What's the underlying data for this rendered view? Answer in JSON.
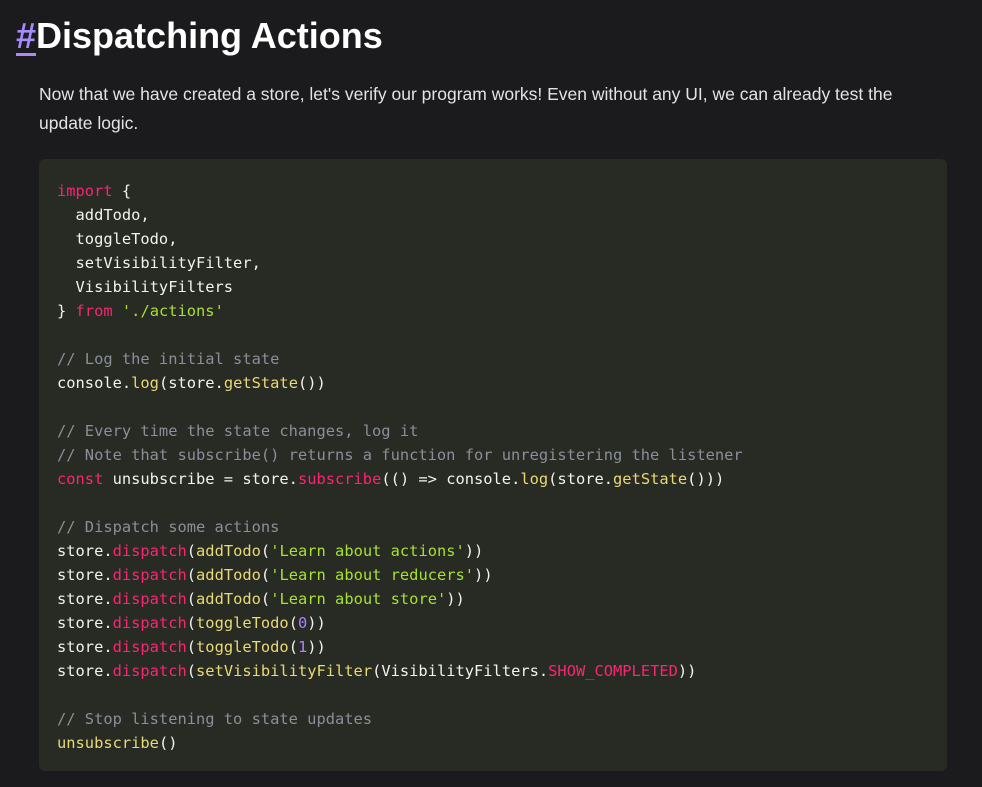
{
  "heading": {
    "hash": "#",
    "title": "Dispatching Actions"
  },
  "paragraph": "Now that we have created a store, let's verify our program works! Even without any UI, we can already test the update logic.",
  "code": {
    "language": "javascript",
    "lines": [
      [
        {
          "t": "import",
          "c": "kw"
        },
        {
          "t": " {",
          "c": "pl"
        }
      ],
      [
        {
          "t": "  addTodo,",
          "c": "pl"
        }
      ],
      [
        {
          "t": "  toggleTodo,",
          "c": "pl"
        }
      ],
      [
        {
          "t": "  setVisibilityFilter,",
          "c": "pl"
        }
      ],
      [
        {
          "t": "  VisibilityFilters",
          "c": "pl"
        }
      ],
      [
        {
          "t": "} ",
          "c": "pl"
        },
        {
          "t": "from",
          "c": "kw"
        },
        {
          "t": " ",
          "c": "pl"
        },
        {
          "t": "'./actions'",
          "c": "str"
        }
      ],
      [],
      [
        {
          "t": "// Log the initial state",
          "c": "cm"
        }
      ],
      [
        {
          "t": "console.",
          "c": "pl"
        },
        {
          "t": "log",
          "c": "fn"
        },
        {
          "t": "(store.",
          "c": "pl"
        },
        {
          "t": "getState",
          "c": "fn"
        },
        {
          "t": "())",
          "c": "pl"
        }
      ],
      [],
      [
        {
          "t": "// Every time the state changes, log it",
          "c": "cm"
        }
      ],
      [
        {
          "t": "// Note that subscribe() returns a function for unregistering the listener",
          "c": "cm"
        }
      ],
      [
        {
          "t": "const",
          "c": "kw"
        },
        {
          "t": " unsubscribe = store.",
          "c": "pl"
        },
        {
          "t": "subscribe",
          "c": "fn2"
        },
        {
          "t": "(() => console.",
          "c": "pl"
        },
        {
          "t": "log",
          "c": "fn"
        },
        {
          "t": "(store.",
          "c": "pl"
        },
        {
          "t": "getState",
          "c": "fn"
        },
        {
          "t": "()))",
          "c": "pl"
        }
      ],
      [],
      [
        {
          "t": "// Dispatch some actions",
          "c": "cm"
        }
      ],
      [
        {
          "t": "store.",
          "c": "pl"
        },
        {
          "t": "dispatch",
          "c": "fn2"
        },
        {
          "t": "(",
          "c": "pl"
        },
        {
          "t": "addTodo",
          "c": "fn3"
        },
        {
          "t": "(",
          "c": "pl"
        },
        {
          "t": "'Learn about actions'",
          "c": "str"
        },
        {
          "t": "))",
          "c": "pl"
        }
      ],
      [
        {
          "t": "store.",
          "c": "pl"
        },
        {
          "t": "dispatch",
          "c": "fn2"
        },
        {
          "t": "(",
          "c": "pl"
        },
        {
          "t": "addTodo",
          "c": "fn3"
        },
        {
          "t": "(",
          "c": "pl"
        },
        {
          "t": "'Learn about reducers'",
          "c": "str"
        },
        {
          "t": "))",
          "c": "pl"
        }
      ],
      [
        {
          "t": "store.",
          "c": "pl"
        },
        {
          "t": "dispatch",
          "c": "fn2"
        },
        {
          "t": "(",
          "c": "pl"
        },
        {
          "t": "addTodo",
          "c": "fn3"
        },
        {
          "t": "(",
          "c": "pl"
        },
        {
          "t": "'Learn about store'",
          "c": "str"
        },
        {
          "t": "))",
          "c": "pl"
        }
      ],
      [
        {
          "t": "store.",
          "c": "pl"
        },
        {
          "t": "dispatch",
          "c": "fn2"
        },
        {
          "t": "(",
          "c": "pl"
        },
        {
          "t": "toggleTodo",
          "c": "fn3"
        },
        {
          "t": "(",
          "c": "pl"
        },
        {
          "t": "0",
          "c": "num"
        },
        {
          "t": "))",
          "c": "pl"
        }
      ],
      [
        {
          "t": "store.",
          "c": "pl"
        },
        {
          "t": "dispatch",
          "c": "fn2"
        },
        {
          "t": "(",
          "c": "pl"
        },
        {
          "t": "toggleTodo",
          "c": "fn3"
        },
        {
          "t": "(",
          "c": "pl"
        },
        {
          "t": "1",
          "c": "num"
        },
        {
          "t": "))",
          "c": "pl"
        }
      ],
      [
        {
          "t": "store.",
          "c": "pl"
        },
        {
          "t": "dispatch",
          "c": "fn2"
        },
        {
          "t": "(",
          "c": "pl"
        },
        {
          "t": "setVisibilityFilter",
          "c": "fn3"
        },
        {
          "t": "(VisibilityFilters.",
          "c": "pl"
        },
        {
          "t": "SHOW_COMPLETED",
          "c": "const"
        },
        {
          "t": "))",
          "c": "pl"
        }
      ],
      [],
      [
        {
          "t": "// Stop listening to state updates",
          "c": "cm"
        }
      ],
      [
        {
          "t": "unsubscribe",
          "c": "fn"
        },
        {
          "t": "()",
          "c": "pl"
        }
      ]
    ]
  },
  "colors": {
    "background": "#1b1b1d",
    "code_background": "#282a24",
    "accent_hash": "#a78bfa",
    "keyword": "#f92672",
    "string": "#a6e22e",
    "comment": "#8a8f98",
    "function": "#e6db74",
    "number": "#ae81ff"
  }
}
